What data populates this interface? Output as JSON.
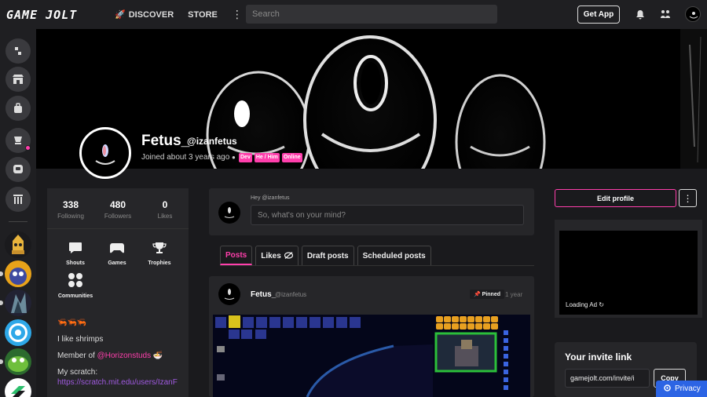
{
  "topbar": {
    "logo": "GAME JOLT",
    "nav": {
      "discover": "DISCOVER",
      "store": "STORE",
      "more": "⋮"
    },
    "search_placeholder": "Search",
    "get_app": "Get App",
    "icons": [
      "bell-icon",
      "activity-icon",
      "avatar"
    ]
  },
  "sidebar": {
    "buttons": [
      "discover-icon",
      "store-icon",
      "inventory-icon",
      "quests-icon",
      "chat-icon",
      "library-icon"
    ]
  },
  "profile": {
    "name": "Fetus_",
    "handle": "@izanfetus",
    "joined": "Joined about 3 years ago",
    "tags": [
      "Dev",
      "He / Him",
      "Online"
    ]
  },
  "stats": [
    {
      "num": "338",
      "label": "Following"
    },
    {
      "num": "480",
      "label": "Followers"
    },
    {
      "num": "0",
      "label": "Likes"
    }
  ],
  "shortcuts": [
    {
      "label": "Shouts",
      "icon": "chat-icon"
    },
    {
      "label": "Games",
      "icon": "gamepad-icon"
    },
    {
      "label": "Trophies",
      "icon": "trophy-icon"
    },
    {
      "label": "Communities",
      "icon": "communities-icon"
    }
  ],
  "bio": {
    "emoji_line": "🦐🦐🦐",
    "line1": "I like shrimps",
    "member_prefix": "Member of ",
    "member_link": "@Horizonstuds",
    "scratch_label": "My scratch:",
    "scratch_link": "https://scratch.mit.edu/users/IzanF"
  },
  "composer": {
    "hint": "Hey @izanfetus",
    "placeholder": "So, what's on your mind?"
  },
  "tabs": [
    "Posts",
    "Likes",
    "Draft posts",
    "Scheduled posts"
  ],
  "post": {
    "name": "Fetus_",
    "handle": "@izanfetus",
    "pinned": "Pinned",
    "time": "1 year"
  },
  "right": {
    "edit_profile": "Edit profile",
    "more": "⋮",
    "ad_loading": "Loading Ad",
    "invite_title": "Your invite link",
    "invite_value": "gamejolt.com/invite/i",
    "copy": "Copy"
  },
  "privacy": "Privacy",
  "colors": {
    "accent": "#ff3fac",
    "privacy": "#2c64e4"
  }
}
